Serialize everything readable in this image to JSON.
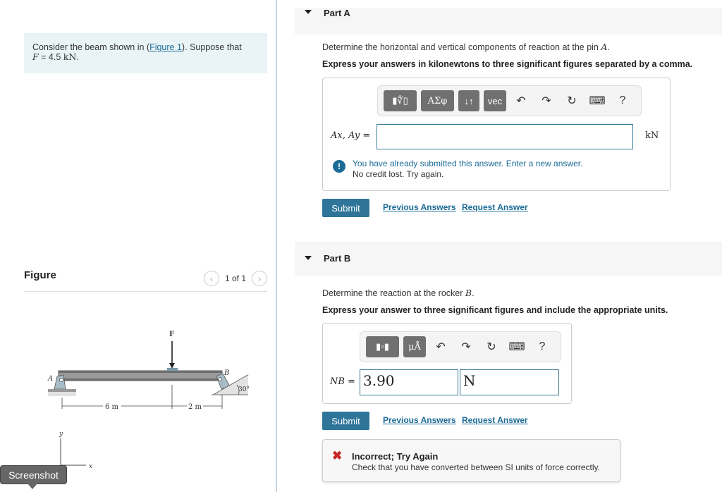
{
  "problem": {
    "text_before": "Consider the beam shown in (",
    "figure_link": "Figure 1",
    "text_after": "). Suppose that",
    "given_var": "F",
    "given_eq": " = 4.5 ",
    "given_unit": "kN",
    "given_end": "."
  },
  "figure": {
    "title": "Figure",
    "pager": "1 of 1",
    "prev_icon": "‹",
    "next_icon": "›",
    "labels": {
      "force": "F",
      "pin": "A",
      "rocker": "B",
      "angle": "30°",
      "dim1": "6 m",
      "dim2": "2 m",
      "axis_y": "y",
      "axis_x": "x"
    }
  },
  "tooltip": {
    "text": "Screenshot"
  },
  "part_a": {
    "title": "Part A",
    "question_before": "Determine the horizontal and vertical components of reaction at the pin ",
    "question_var": "A",
    "question_after": ".",
    "instruction": "Express your answers in kilonewtons to three significant figures separated by a comma.",
    "toolbar": {
      "templates": "▮∜▯",
      "greek": "ΑΣφ",
      "arrows": "↓↑",
      "vec": "vec",
      "undo": "↶",
      "redo": "↷",
      "reset": "↻",
      "keyboard": "⌨",
      "help": "?"
    },
    "input_label": "Ax, Ay =",
    "input_value": "",
    "unit": "kN",
    "notice_line1": "You have already submitted this answer. Enter a new answer.",
    "notice_line2": "No credit lost. Try again.",
    "notice_icon": "!",
    "submit": "Submit",
    "prev_answers": "Previous Answers",
    "request_answer": "Request Answer"
  },
  "part_b": {
    "title": "Part B",
    "question_before": "Determine the reaction at the rocker ",
    "question_var": "B",
    "question_after": ".",
    "instruction": "Express your answer to three significant figures and include the appropriate units.",
    "toolbar": {
      "templates": "▮▫▮",
      "units": "μÅ",
      "undo": "↶",
      "redo": "↷",
      "reset": "↻",
      "keyboard": "⌨",
      "help": "?"
    },
    "input_label": "NB =",
    "value": "3.90",
    "unit_value": "N",
    "submit": "Submit",
    "prev_answers": "Previous Answers",
    "request_answer": "Request Answer",
    "feedback": {
      "icon": "✖",
      "title": "Incorrect; Try Again",
      "message": "Check that you have converted between SI units of force correctly."
    }
  }
}
